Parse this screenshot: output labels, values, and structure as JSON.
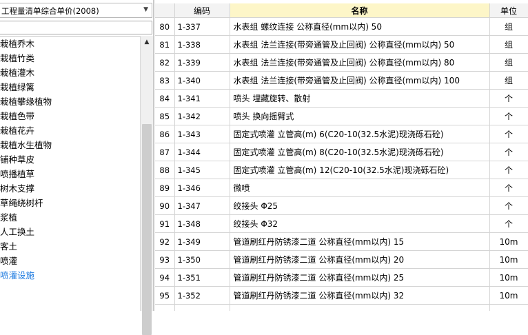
{
  "left_panel": {
    "combo_label": "工程量清单综合单价(2008)",
    "filter_placeholder": "",
    "tree_items": [
      "栽植乔木",
      "栽植竹类",
      "栽植灌木",
      "栽植绿篱",
      "栽植攀缘植物",
      "栽植色带",
      "栽植花卉",
      "栽植水生植物",
      "铺种草皮",
      "喷播植草",
      "树木支撑",
      "草绳绕树杆",
      "浆植",
      "人工换土",
      "客土",
      "喷灌",
      "喷灌设施"
    ],
    "selected_item_index": 16
  },
  "grid": {
    "columns": {
      "code": "编码",
      "name": "名称",
      "unit": "单位"
    },
    "rows": [
      {
        "num": "80",
        "code": "1-337",
        "name": "水表组  螺纹连接  公称直径(mm以内) 50",
        "unit": "组"
      },
      {
        "num": "81",
        "code": "1-338",
        "name": "水表组  法兰连接(带旁通管及止回阀) 公称直径(mm以内) 50",
        "unit": "组"
      },
      {
        "num": "82",
        "code": "1-339",
        "name": "水表组  法兰连接(带旁通管及止回阀) 公称直径(mm以内) 80",
        "unit": "组"
      },
      {
        "num": "83",
        "code": "1-340",
        "name": "水表组  法兰连接(带旁通管及止回阀) 公称直径(mm以内) 100",
        "unit": "组"
      },
      {
        "num": "84",
        "code": "1-341",
        "name": "喷头  埋藏旋转、散射",
        "unit": "个"
      },
      {
        "num": "85",
        "code": "1-342",
        "name": "喷头  换向摇臂式",
        "unit": "个"
      },
      {
        "num": "86",
        "code": "1-343",
        "name": "固定式喷灌  立管高(m) 6(C20-10(32.5水泥)现浇砾石砼)",
        "unit": "个"
      },
      {
        "num": "87",
        "code": "1-344",
        "name": "固定式喷灌  立管高(m) 8(C20-10(32.5水泥)现浇砾石砼)",
        "unit": "个"
      },
      {
        "num": "88",
        "code": "1-345",
        "name": "固定式喷灌  立管高(m) 12(C20-10(32.5水泥)现浇砾石砼)",
        "unit": "个"
      },
      {
        "num": "89",
        "code": "1-346",
        "name": "微喷",
        "unit": "个"
      },
      {
        "num": "90",
        "code": "1-347",
        "name": "绞接头  Φ25",
        "unit": "个"
      },
      {
        "num": "91",
        "code": "1-348",
        "name": "绞接头  Φ32",
        "unit": "个"
      },
      {
        "num": "92",
        "code": "1-349",
        "name": "管道刷红丹防锈漆二道  公称直径(mm以内) 15",
        "unit": "10m"
      },
      {
        "num": "93",
        "code": "1-350",
        "name": "管道刷红丹防锈漆二道  公称直径(mm以内) 20",
        "unit": "10m"
      },
      {
        "num": "94",
        "code": "1-351",
        "name": "管道刷红丹防锈漆二道  公称直径(mm以内) 25",
        "unit": "10m"
      },
      {
        "num": "95",
        "code": "1-352",
        "name": "管道刷红丹防锈漆二道  公称直径(mm以内) 32",
        "unit": "10m"
      }
    ]
  },
  "colors": {
    "header_name_bg": "#fdf6c8",
    "selected_text": "#1e7be0",
    "grid_line": "#d4d4d4"
  }
}
